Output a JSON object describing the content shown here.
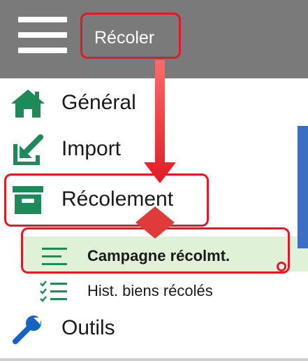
{
  "header": {
    "title": "Récoler",
    "menu_icon": "hamburger-icon",
    "background": "#7a7a7a"
  },
  "nav": {
    "items": [
      {
        "label": "Général",
        "icon": "home-icon",
        "color": "#1e8a5a"
      },
      {
        "label": "Import",
        "icon": "import-icon",
        "color": "#1e8a5a"
      },
      {
        "label": "Récolement",
        "icon": "archive-box-icon",
        "color": "#1e8a5a"
      },
      {
        "label": "Outils",
        "icon": "wrench-icon",
        "color": "#1565c0"
      }
    ],
    "sub_items": [
      {
        "label": "Campagne récolmt.",
        "icon": "list-icon",
        "selected": true
      },
      {
        "label": "Hist. biens récolés",
        "icon": "checklist-icon",
        "selected": false
      }
    ]
  },
  "annotations": {
    "highlight_color": "#e01b24",
    "selection_color": "#dff2d8"
  }
}
